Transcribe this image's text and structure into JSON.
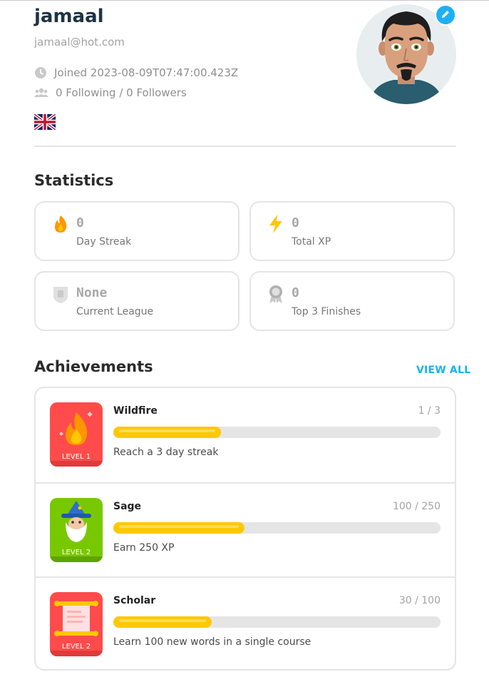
{
  "profile": {
    "username": "jamaal",
    "email": "jamaal@hot.com",
    "joined": "Joined 2023-08-09T07:47:00.423Z",
    "follow": "0 Following / 0 Followers",
    "flag_icon": "uk-flag-icon"
  },
  "statistics": {
    "title": "Statistics",
    "items": [
      {
        "value": "0",
        "label": "Day Streak",
        "icon": "fire-icon",
        "color": "#ff9600"
      },
      {
        "value": "0",
        "label": "Total XP",
        "icon": "lightning-icon",
        "color": "#ffc800"
      },
      {
        "value": "None",
        "label": "Current League",
        "icon": "shield-icon",
        "color": "#d6d6d6"
      },
      {
        "value": "0",
        "label": "Top 3 Finishes",
        "icon": "medal-icon",
        "color": "#b0b0b0"
      }
    ]
  },
  "achievements": {
    "title": "Achievements",
    "view_all": "VIEW ALL",
    "items": [
      {
        "name": "Wildfire",
        "progress_text": "1 / 3",
        "progress": 0.33,
        "description": "Reach a 3 day streak",
        "level": "LEVEL 1",
        "icon": "wildfire-badge-icon",
        "color": "#ff4b4b"
      },
      {
        "name": "Sage",
        "progress_text": "100 / 250",
        "progress": 0.4,
        "description": "Earn 250 XP",
        "level": "LEVEL 2",
        "icon": "sage-badge-icon",
        "color": "#78c800"
      },
      {
        "name": "Scholar",
        "progress_text": "30 / 100",
        "progress": 0.3,
        "description": "Learn 100 new words in a single course",
        "level": "LEVEL 2",
        "icon": "scholar-badge-icon",
        "color": "#ff4b4b"
      }
    ]
  },
  "colors": {
    "accent": "#1cb0f6",
    "progress": "#ffc800",
    "border": "#e5e5e5"
  }
}
